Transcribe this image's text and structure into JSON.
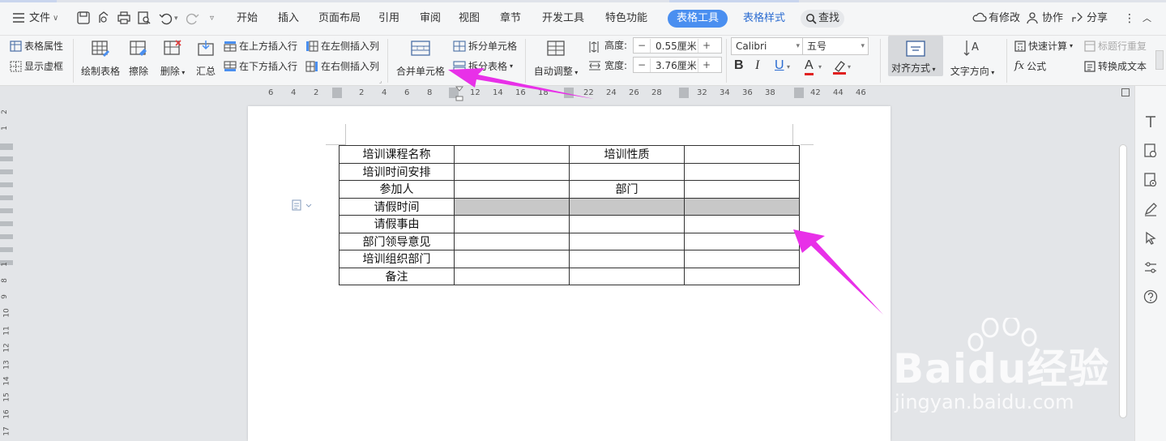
{
  "titlebar": {
    "file_menu": "文件",
    "tabs": [
      "开始",
      "插入",
      "页面布局",
      "引用",
      "审阅",
      "视图",
      "章节",
      "开发工具",
      "特色功能"
    ],
    "active_tab": "表格工具",
    "style_tab": "表格样式",
    "search": "查找",
    "modified": "有修改",
    "collab": "协作",
    "share": "分享",
    "accent": "#4a8ff0"
  },
  "ribbon": {
    "table_props": "表格属性",
    "show_grid": "显示虚框",
    "draw_table": "绘制表格",
    "erase": "擦除",
    "delete": "删除",
    "summary": "汇总",
    "insert_above": "在上方插入行",
    "insert_below": "在下方插入行",
    "insert_left": "在左侧插入列",
    "insert_right": "在右侧插入列",
    "merge_cells": "合并单元格",
    "split_cells": "拆分单元格",
    "split_table": "拆分表格",
    "auto_adjust": "自动调整",
    "height_label": "高度:",
    "height_value": "0.55厘米",
    "width_label": "宽度:",
    "width_value": "3.76厘米",
    "font_name": "Calibri",
    "font_size": "五号",
    "bold": "B",
    "italic": "I",
    "underline": "U",
    "font_color_letter": "A",
    "align": "对齐方式",
    "text_direction": "文字方向",
    "quick_calc": "快速计算",
    "repeat_header": "标题行重复",
    "formula_prefix": "fx",
    "formula": "公式",
    "to_text": "转换成文本",
    "font_color": "#e02020",
    "highlight_color": "#e02020"
  },
  "ruler": {
    "numbers": [
      "6",
      "4",
      "2",
      "2",
      "4",
      "6",
      "8",
      "12",
      "14",
      "16",
      "18",
      "22",
      "24",
      "26",
      "28",
      "32",
      "34",
      "36",
      "38",
      "42",
      "44",
      "46"
    ]
  },
  "vruler": {
    "numbers": [
      "2",
      "1",
      "1",
      "8",
      "9",
      "10",
      "11",
      "12",
      "13",
      "14",
      "15",
      "16",
      "17"
    ]
  },
  "document": {
    "rows": [
      [
        "培训课程名称",
        "",
        "培训性质",
        ""
      ],
      [
        "培训时间安排",
        "",
        "",
        ""
      ],
      [
        "参加人",
        "",
        "部门",
        ""
      ],
      [
        "请假时间",
        "",
        "",
        ""
      ],
      [
        "请假事由",
        "",
        "",
        ""
      ],
      [
        "部门领导意见",
        "",
        "",
        ""
      ],
      [
        "培训组织部门",
        "",
        "",
        ""
      ],
      [
        "备注",
        "",
        "",
        ""
      ]
    ],
    "shaded_row_index": 3,
    "shade_color": "#c8c8c8"
  },
  "annotation": {
    "arrow_color": "#e830e8"
  },
  "watermark": {
    "brand": "Baidu经验",
    "url": "jingyan.baidu.com"
  }
}
